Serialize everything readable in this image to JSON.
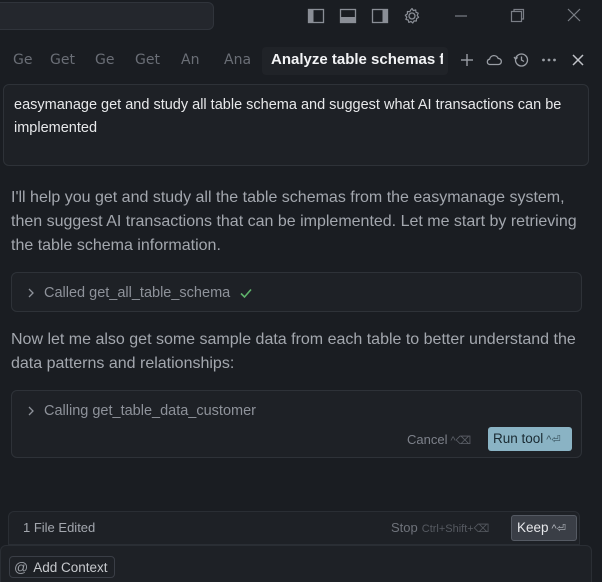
{
  "titlebar": {
    "icons": [
      "toggle-sidebar-icon",
      "toggle-panel-icon",
      "toggle-secondary-sidebar-icon",
      "settings-gear-icon"
    ],
    "window_controls": [
      "minimize-icon",
      "restore-icon",
      "close-icon"
    ]
  },
  "tabs": [
    {
      "label": "Ge"
    },
    {
      "label": "Get"
    },
    {
      "label": "Ge"
    },
    {
      "label": "Get"
    },
    {
      "label": "An"
    },
    {
      "label": "Ana"
    },
    {
      "label": "Analyze table schemas fo",
      "active": true
    }
  ],
  "tab_actions": [
    "plus-icon",
    "cloud-icon",
    "history-icon",
    "more-icon",
    "close-icon"
  ],
  "prompt": {
    "text": "easymanage get and study all table schema and suggest what AI transactions can be implemented"
  },
  "messages": {
    "intro": "I'll help you get and study all the table schemas from the easymanage system, then suggest AI transactions that can be implemented. Let me start by retrieving the table schema information.",
    "tool_call_1": "Called get_all_table_schema",
    "follow_up": "Now let me also get some sample data from each table to better understand the data patterns and relationships:",
    "tool_call_2": "Calling get_table_data_customer"
  },
  "tool_actions": {
    "cancel_label": "Cancel",
    "cancel_shortcut": "^⌫",
    "run_label": "Run tool",
    "run_shortcut": "^⏎"
  },
  "footer": {
    "files_edited": "1 File Edited",
    "stop_label": "Stop",
    "stop_shortcut": "Ctrl+Shift+⌫",
    "keep_label": "Keep",
    "keep_shortcut": "^⏎",
    "add_context": "Add Context"
  },
  "colors": {
    "background": "#1a1d22",
    "run_button": "#8ab3c4",
    "success_check": "#5fb36b"
  }
}
